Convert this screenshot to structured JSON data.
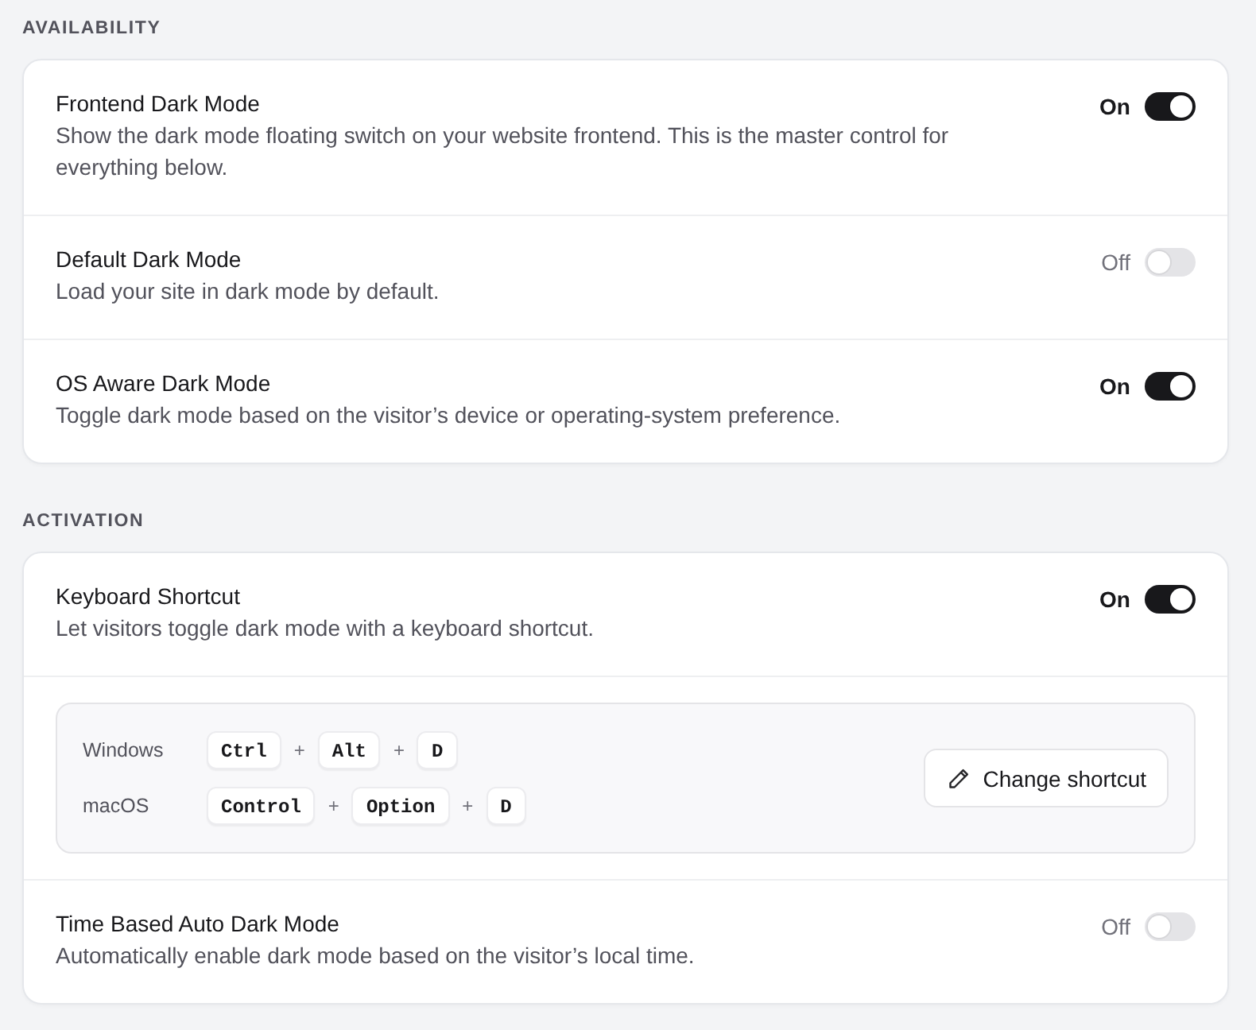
{
  "sections": [
    {
      "heading": "AVAILABILITY",
      "settings": [
        {
          "kind": "toggle",
          "title": "Frontend Dark Mode",
          "description": "Show the dark mode floating switch on your website frontend. This is the master control for everything below.",
          "state_label": "On",
          "on": true
        },
        {
          "kind": "toggle",
          "title": "Default Dark Mode",
          "description": "Load your site in dark mode by default.",
          "state_label": "Off",
          "on": false
        },
        {
          "kind": "toggle",
          "title": "OS Aware Dark Mode",
          "description": "Toggle dark mode based on the visitor’s device or operating-system preference.",
          "state_label": "On",
          "on": true
        }
      ]
    },
    {
      "heading": "ACTIVATION",
      "settings": [
        {
          "kind": "toggle",
          "title": "Keyboard Shortcut",
          "description": "Let visitors toggle dark mode with a keyboard shortcut.",
          "state_label": "On",
          "on": true
        },
        {
          "kind": "shortcuts",
          "platforms": [
            {
              "name": "Windows",
              "combo": [
                {
                  "kind": "key",
                  "text": "Ctrl"
                },
                {
                  "kind": "plus",
                  "text": "+"
                },
                {
                  "kind": "key",
                  "text": "Alt"
                },
                {
                  "kind": "plus",
                  "text": "+"
                },
                {
                  "kind": "key",
                  "text": "D"
                }
              ]
            },
            {
              "name": "macOS",
              "combo": [
                {
                  "kind": "key",
                  "text": "Control"
                },
                {
                  "kind": "plus",
                  "text": "+"
                },
                {
                  "kind": "key",
                  "text": "Option"
                },
                {
                  "kind": "plus",
                  "text": "+"
                },
                {
                  "kind": "key",
                  "text": "D"
                }
              ]
            }
          ],
          "button": "Change shortcut"
        },
        {
          "kind": "toggle",
          "title": "Time Based Auto Dark Mode",
          "description": "Automatically enable dark mode based on the visitor’s local time.",
          "state_label": "Off",
          "on": false
        }
      ]
    }
  ]
}
